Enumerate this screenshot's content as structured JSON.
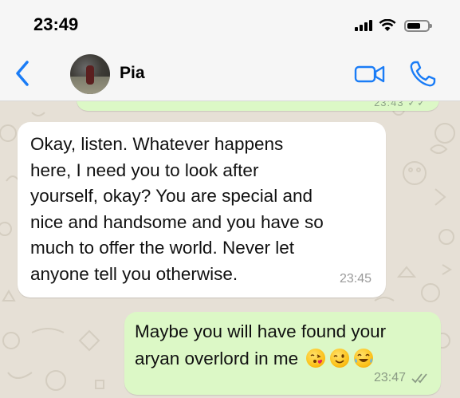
{
  "status_bar": {
    "time": "23:49"
  },
  "header": {
    "contact_name": "Pia"
  },
  "messages": {
    "previous_time_partial": "23:43 ✓✓",
    "incoming": {
      "text": "Okay, listen. Whatever happens\nhere, I need you to look after\nyourself, okay? You are special and\nnice and handsome and you have so\nmuch to offer the world. Never let\nanyone tell you otherwise.",
      "time": "23:45"
    },
    "outgoing": {
      "line1": "Maybe you will have found your",
      "line2": "aryan overlord in me",
      "emojis": [
        "kissing-heart-emoji",
        "winking-emoji",
        "tears-of-joy-emoji"
      ],
      "time": "23:47"
    }
  },
  "colors": {
    "accent": "#1a7cf6",
    "outgoing_bubble": "#dcf8c6",
    "incoming_bubble": "#ffffff",
    "wallpaper": "#e6e0d6",
    "read_ticks": "#8a9a84"
  }
}
